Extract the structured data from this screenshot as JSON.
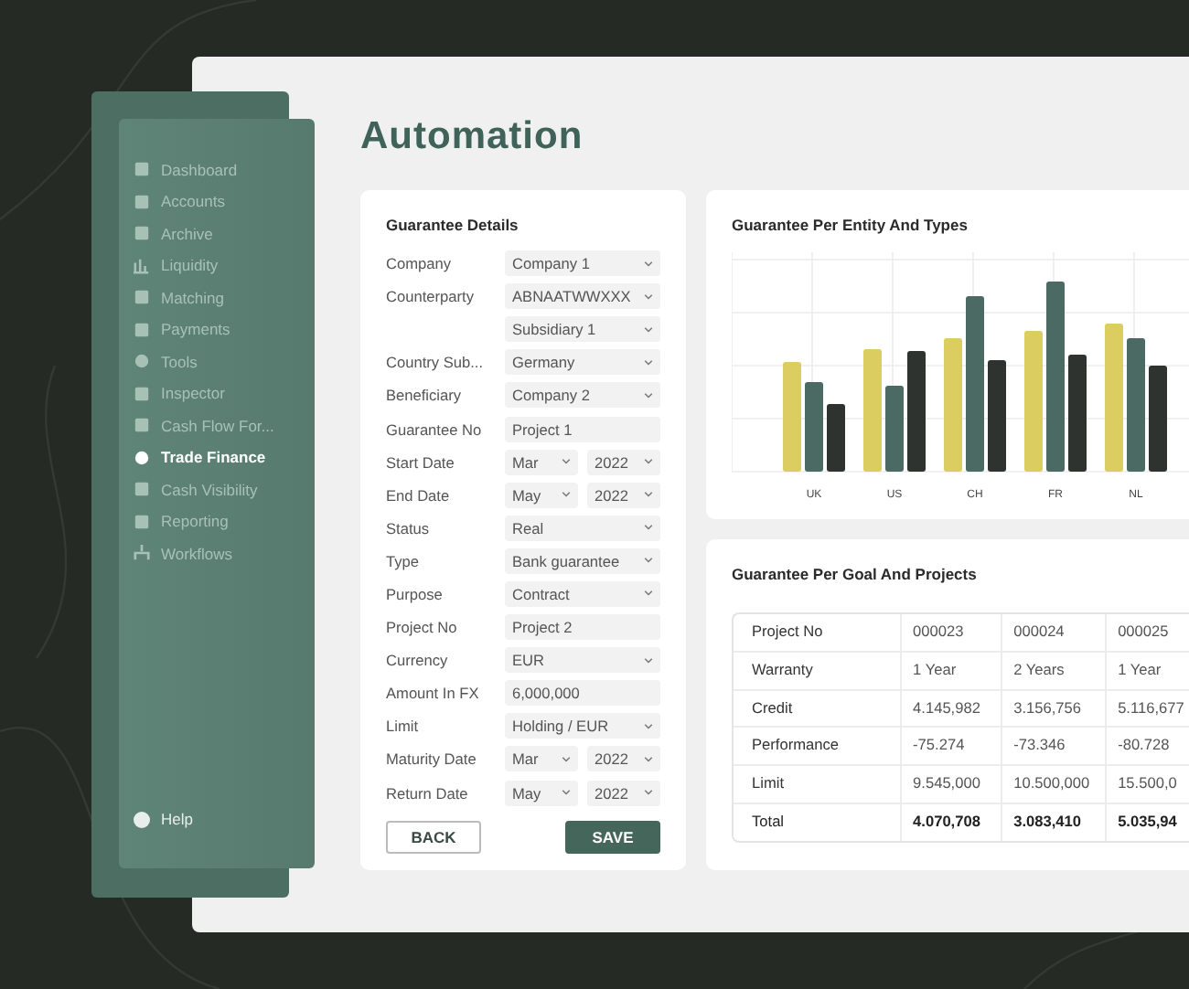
{
  "sidebar": {
    "items": [
      {
        "label": "Dashboard",
        "selected": false
      },
      {
        "label": "Accounts",
        "selected": false
      },
      {
        "label": "Archive",
        "selected": false
      },
      {
        "label": "Liquidity",
        "selected": false
      },
      {
        "label": "Matching",
        "selected": false
      },
      {
        "label": "Payments",
        "selected": false
      },
      {
        "label": "Tools",
        "selected": false
      },
      {
        "label": "Inspector",
        "selected": false
      },
      {
        "label": "Cash Flow For...",
        "selected": false
      },
      {
        "label": "Trade Finance",
        "selected": true
      },
      {
        "label": "Cash Visibility",
        "selected": false
      },
      {
        "label": "Reporting",
        "selected": false
      },
      {
        "label": "Workflows",
        "selected": false
      }
    ],
    "help": "Help"
  },
  "page_title": "Automation",
  "form": {
    "title": "Guarantee Details",
    "fields": [
      {
        "kind": "select",
        "label": "Company",
        "value": "Company 1"
      },
      {
        "kind": "select",
        "label": "Counterparty",
        "value": "ABNAATWWXXX"
      },
      {
        "kind": "select",
        "value": "Subsidiary 1"
      },
      {
        "kind": "select",
        "label": "Country Sub...",
        "value": "Germany"
      },
      {
        "kind": "select",
        "label": "Beneficiary",
        "value": "Company 2"
      },
      {
        "kind": "input",
        "label": "Guarantee No",
        "value": "Project 1"
      },
      {
        "kind": "date",
        "label": "Start Date",
        "month": "Mar",
        "year": "2022"
      },
      {
        "kind": "date",
        "label": "End Date",
        "month": "May",
        "year": "2022"
      },
      {
        "kind": "select",
        "label": "Status",
        "value": "Real"
      },
      {
        "kind": "select",
        "label": "Type",
        "value": "Bank guarantee"
      },
      {
        "kind": "select",
        "label": "Purpose",
        "value": "Contract"
      },
      {
        "kind": "input",
        "label": "Project No",
        "value": "Project 2"
      },
      {
        "kind": "select",
        "label": "Currency",
        "value": "EUR"
      },
      {
        "kind": "input",
        "label": "Amount In FX",
        "value": "6,000,000"
      },
      {
        "kind": "select",
        "label": "Limit",
        "value": "Holding / EUR"
      },
      {
        "kind": "date",
        "label": "Maturity Date",
        "month": "Mar",
        "year": "2022"
      },
      {
        "kind": "date",
        "label": "Return Date",
        "month": "May",
        "year": "2022"
      }
    ],
    "buttons": [
      {
        "kind": "secondary",
        "label": "BACK"
      },
      {
        "kind": "primary",
        "label": "SAVE"
      }
    ]
  },
  "entity_chart": {
    "title": "Guarantee Per Entity And Types",
    "x_labels": [
      "UK",
      "US",
      "CH",
      "FR",
      "NL"
    ]
  },
  "goal_table": {
    "title": "Guarantee Per Goal And Projects",
    "rows": [
      {
        "cells": [
          "Project No",
          "000023",
          "000024",
          "000025"
        ],
        "bold": false
      },
      {
        "cells": [
          "Warranty",
          "1 Year",
          "2 Years",
          "1 Year"
        ],
        "bold": false
      },
      {
        "cells": [
          "Credit",
          "4.145,982",
          "3.156,756",
          "5.116,677"
        ],
        "bold": false
      },
      {
        "cells": [
          "Performance",
          "-75.274",
          "-73.346",
          "-80.728"
        ],
        "bold": false
      },
      {
        "cells": [
          "Limit",
          "9.545,000",
          "10.500,000",
          "15.500,0"
        ],
        "bold": false
      },
      {
        "cells": [
          "Total",
          "4.070,708",
          "3.083,410",
          "5.035,94"
        ],
        "bold": true
      }
    ]
  }
}
